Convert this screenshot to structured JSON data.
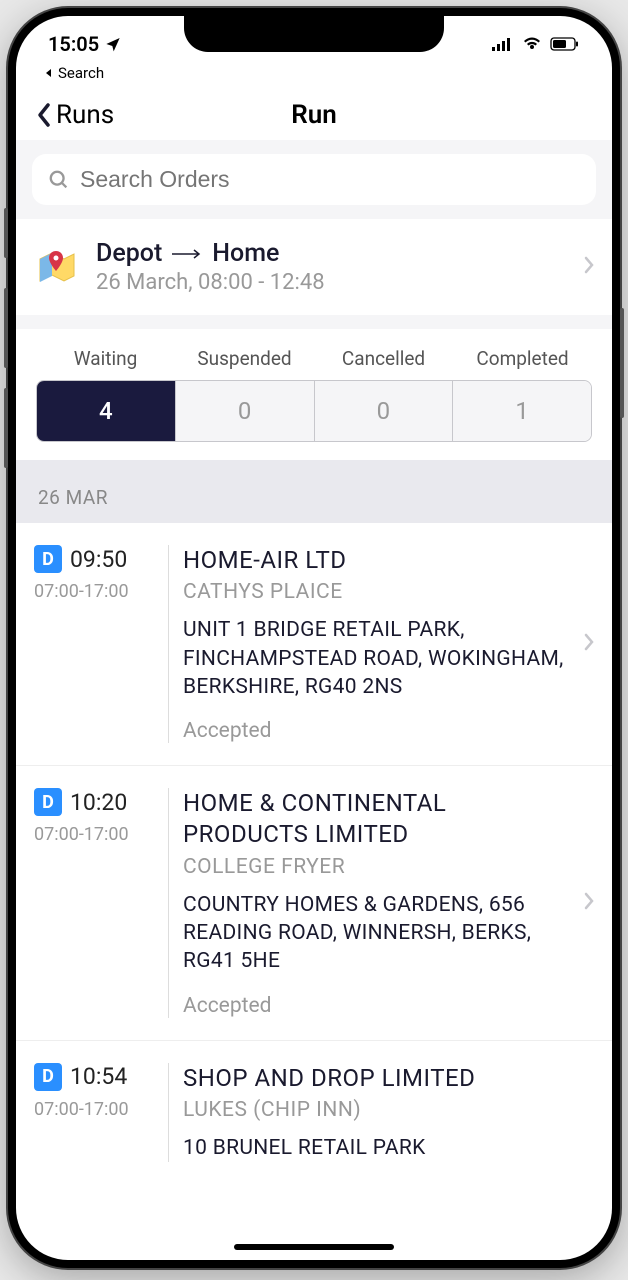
{
  "status": {
    "time": "15:05",
    "back_app": "Search"
  },
  "nav": {
    "back": "Runs",
    "title": "Run"
  },
  "search": {
    "placeholder": "Search Orders"
  },
  "route": {
    "from": "Depot",
    "to": "Home",
    "subtitle": "26 March, 08:00 - 12:48"
  },
  "tabs": [
    {
      "label": "Waiting",
      "count": "4",
      "active": true
    },
    {
      "label": "Suspended",
      "count": "0",
      "active": false
    },
    {
      "label": "Cancelled",
      "count": "0",
      "active": false
    },
    {
      "label": "Completed",
      "count": "1",
      "active": false
    }
  ],
  "date_header": "26 MAR",
  "badge_letter": "D",
  "orders": [
    {
      "time": "09:50",
      "window": "07:00-17:00",
      "title": "HOME-AIR LTD",
      "sub": "CATHYS PLAICE",
      "addr": "UNIT 1 BRIDGE RETAIL PARK, FINCHAMPSTEAD ROAD, WOKINGHAM, BERKSHIRE, RG40 2NS",
      "status": "Accepted"
    },
    {
      "time": "10:20",
      "window": "07:00-17:00",
      "title": "HOME & CONTINENTAL PRODUCTS LIMITED",
      "sub": "COLLEGE FRYER",
      "addr": "COUNTRY HOMES & GARDENS, 656 READING ROAD, WINNERSH, BERKS, RG41 5HE",
      "status": "Accepted"
    },
    {
      "time": "10:54",
      "window": "07:00-17:00",
      "title": "SHOP AND DROP LIMITED",
      "sub": "LUKES (CHIP INN)",
      "addr": "10 BRUNEL RETAIL PARK",
      "status": ""
    }
  ]
}
